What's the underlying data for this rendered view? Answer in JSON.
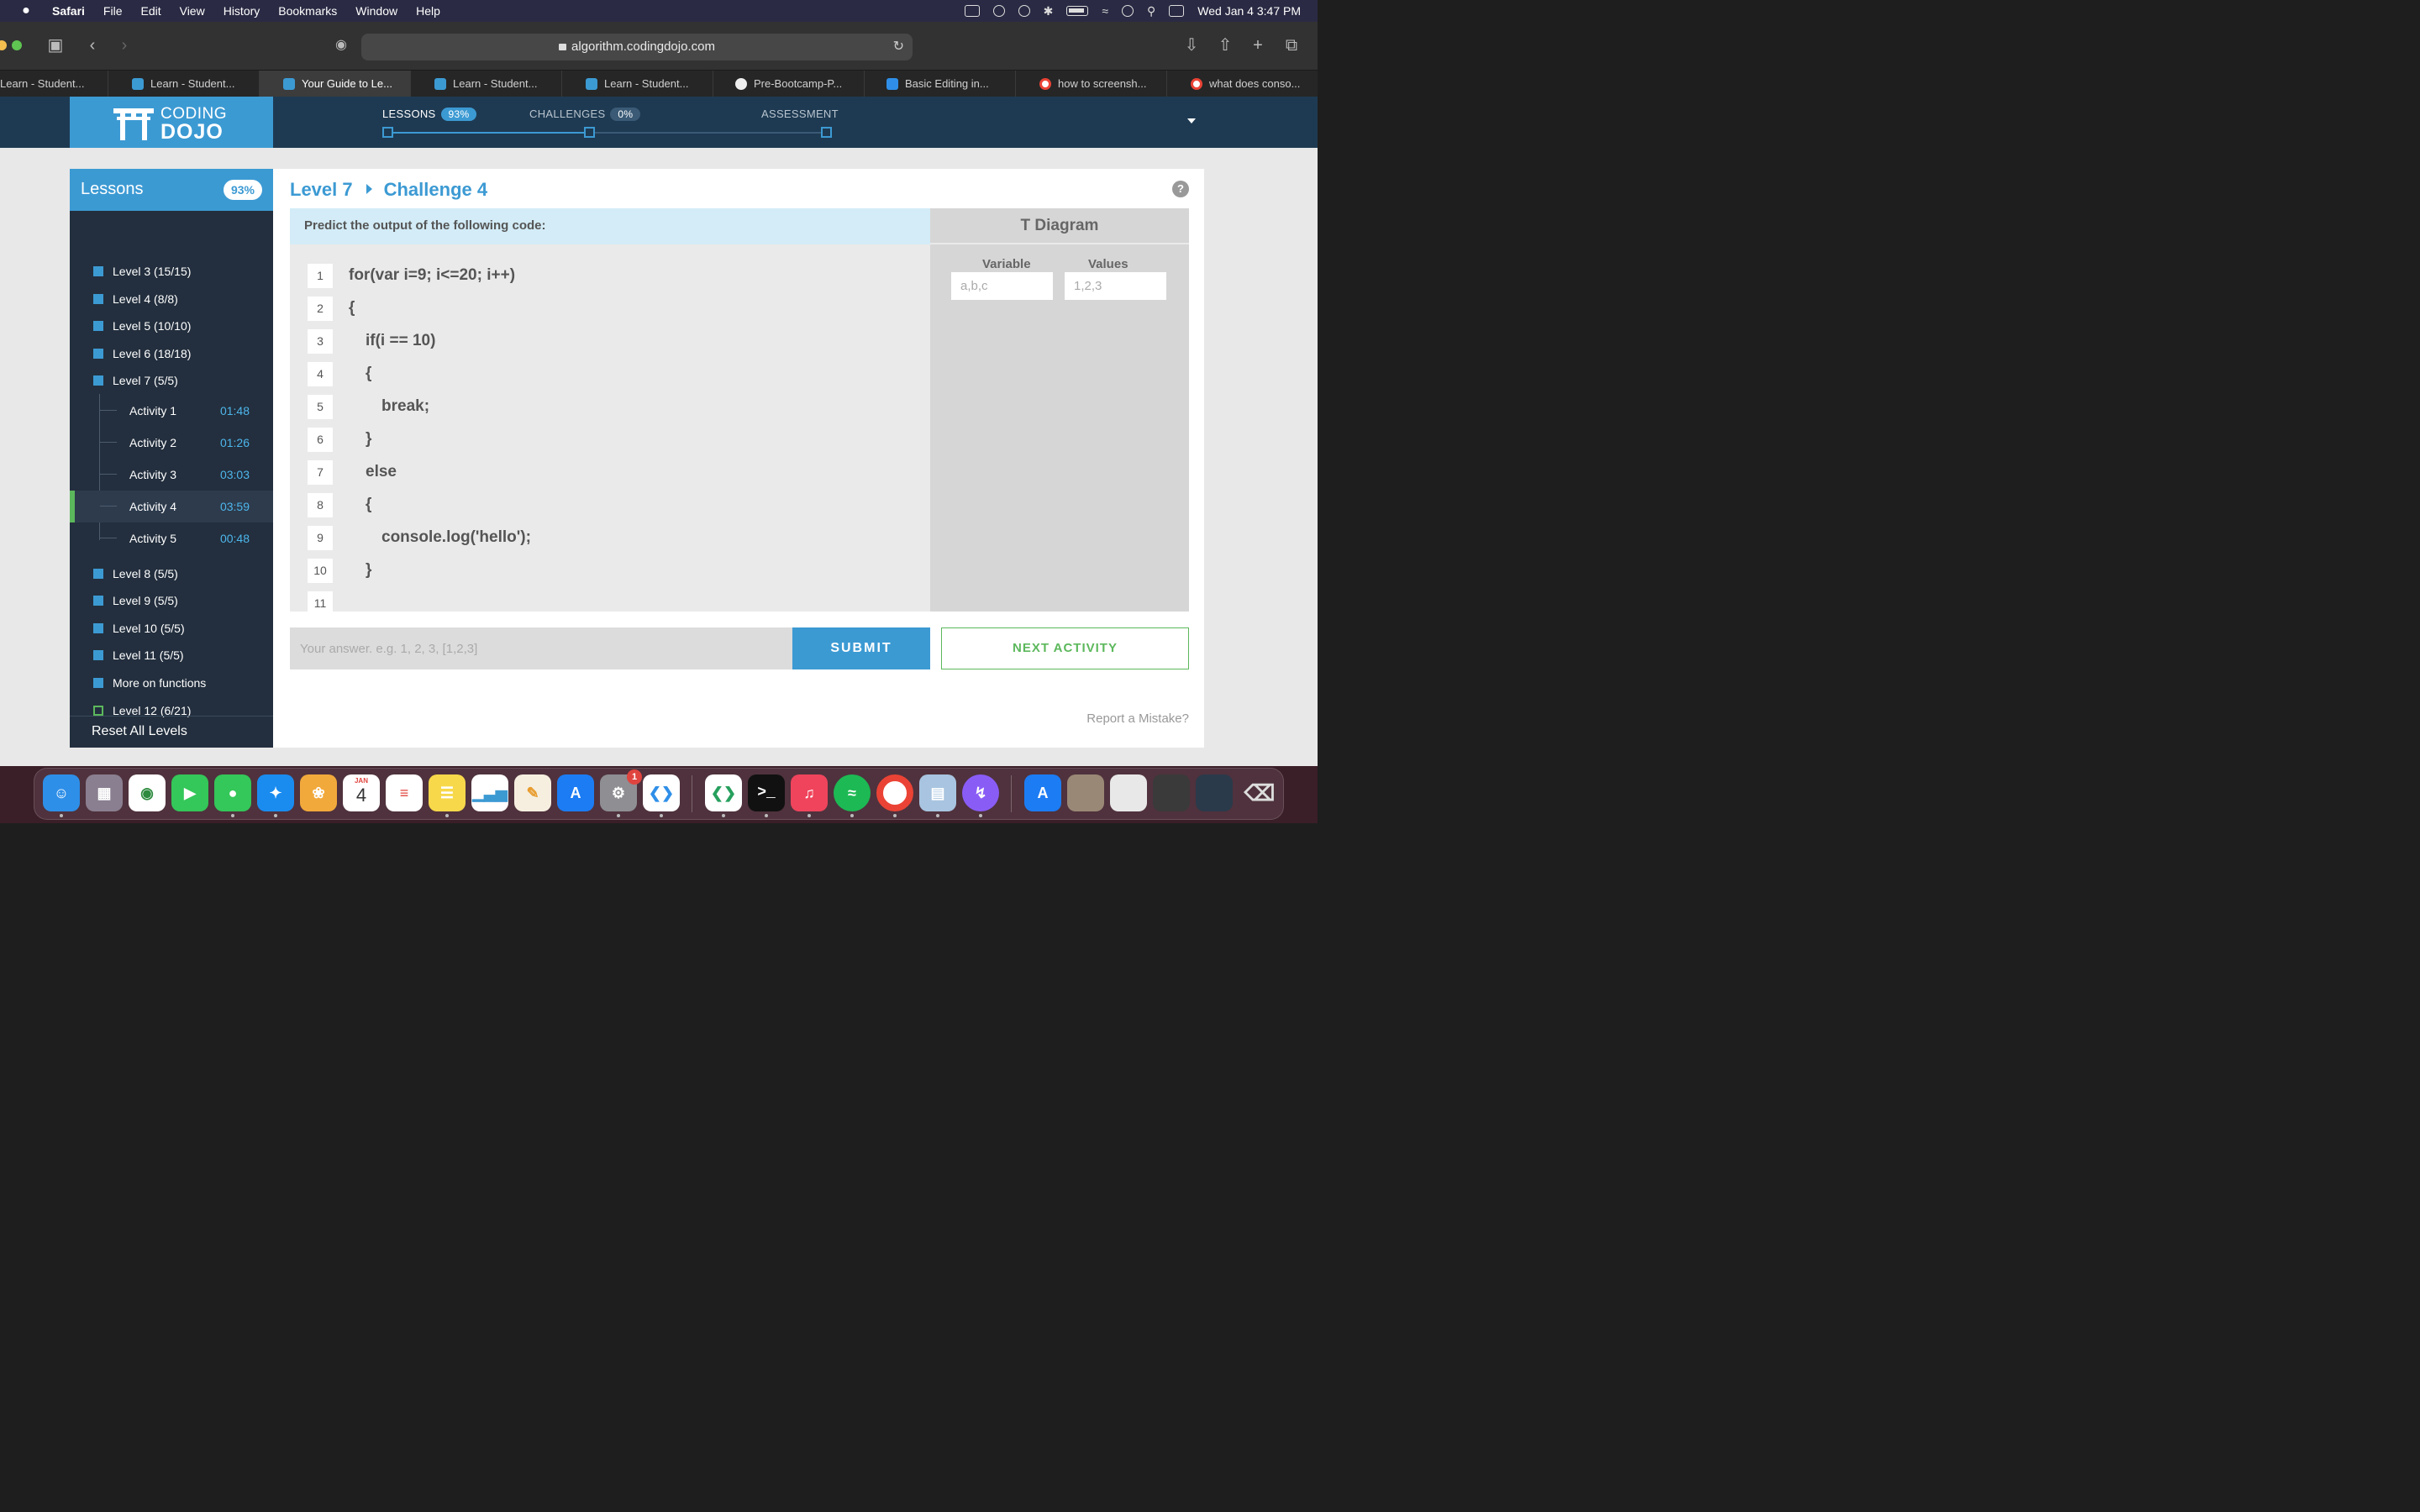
{
  "menubar": {
    "app": "Safari",
    "items": [
      "File",
      "Edit",
      "View",
      "History",
      "Bookmarks",
      "Window",
      "Help"
    ],
    "clock": "Wed Jan 4  3:47 PM"
  },
  "browser": {
    "url": "algorithm.codingdojo.com",
    "tabs": [
      {
        "label": "Learn - Student...",
        "icon": "learn-favicon",
        "color": "#3c9ad3",
        "active": false
      },
      {
        "label": "Learn - Student...",
        "icon": "learn-favicon",
        "color": "#3c9ad3",
        "active": false
      },
      {
        "label": "Your Guide to Le...",
        "icon": "learn-favicon",
        "color": "#3c9ad3",
        "active": true
      },
      {
        "label": "Learn - Student...",
        "icon": "learn-favicon",
        "color": "#3c9ad3",
        "active": false
      },
      {
        "label": "Learn - Student...",
        "icon": "learn-favicon",
        "color": "#3c9ad3",
        "active": false
      },
      {
        "label": "Pre-Bootcamp-P...",
        "icon": "github-favicon",
        "color": "#eeeeee",
        "active": false
      },
      {
        "label": "Basic Editing in...",
        "icon": "vscode-favicon",
        "color": "#2f8fe8",
        "active": false
      },
      {
        "label": "how to screensh...",
        "icon": "google-favicon",
        "color": "#ffffff",
        "active": false
      },
      {
        "label": "what does conso...",
        "icon": "google-favicon",
        "color": "#ffffff",
        "active": false
      }
    ]
  },
  "site": {
    "logo_top": "CODING",
    "logo_bottom": "DOJO",
    "progress": {
      "lessons_label": "LESSONS",
      "lessons_pct": "93%",
      "challenges_label": "CHALLENGES",
      "challenges_pct": "0%",
      "assessment_label": "ASSESSMENT"
    }
  },
  "sidebar": {
    "title": "Lessons",
    "pct": "93%",
    "levels_top": [
      "Level 3 (15/15)",
      "Level 4 (8/8)",
      "Level 5 (10/10)",
      "Level 6 (18/18)",
      "Level 7 (5/5)"
    ],
    "activities": [
      {
        "label": "Activity 1",
        "time": "01:48"
      },
      {
        "label": "Activity 2",
        "time": "01:26"
      },
      {
        "label": "Activity 3",
        "time": "03:03"
      },
      {
        "label": "Activity 4",
        "time": "03:59"
      },
      {
        "label": "Activity 5",
        "time": "00:48"
      }
    ],
    "levels_bottom": [
      "Level 8 (5/5)",
      "Level 9 (5/5)",
      "Level 10 (5/5)",
      "Level 11 (5/5)",
      "More on functions",
      "Level 12 (6/21)"
    ],
    "reset": "Reset All Levels"
  },
  "main": {
    "breadcrumb_level": "Level 7",
    "breadcrumb_challenge": "Challenge 4",
    "prompt": "Predict the output of the following code:",
    "code_lines": [
      {
        "n": "1",
        "code": "for(var i=9; i<=20; i++)"
      },
      {
        "n": "2",
        "code": "{"
      },
      {
        "n": "3",
        "code": "if(i == 10)"
      },
      {
        "n": "4",
        "code": "{"
      },
      {
        "n": "5",
        "code": "break;"
      },
      {
        "n": "6",
        "code": "}"
      },
      {
        "n": "7",
        "code": "else"
      },
      {
        "n": "8",
        "code": "{"
      },
      {
        "n": "9",
        "code": "console.log('hello');"
      },
      {
        "n": "10",
        "code": "}"
      },
      {
        "n": "11",
        "code": ""
      }
    ],
    "tdiagram": {
      "title": "T Diagram",
      "variable_label": "Variable",
      "values_label": "Values",
      "variable_placeholder": "a,b,c",
      "values_placeholder": "1,2,3"
    },
    "answer_placeholder": "Your answer. e.g. 1, 2, 3, [1,2,3]",
    "submit": "SUBMIT",
    "next": "NEXT ACTIVITY",
    "report": "Report a Mistake?"
  },
  "dock": {
    "calendar_month": "JAN",
    "calendar_day": "4",
    "settings_badge": "1"
  }
}
